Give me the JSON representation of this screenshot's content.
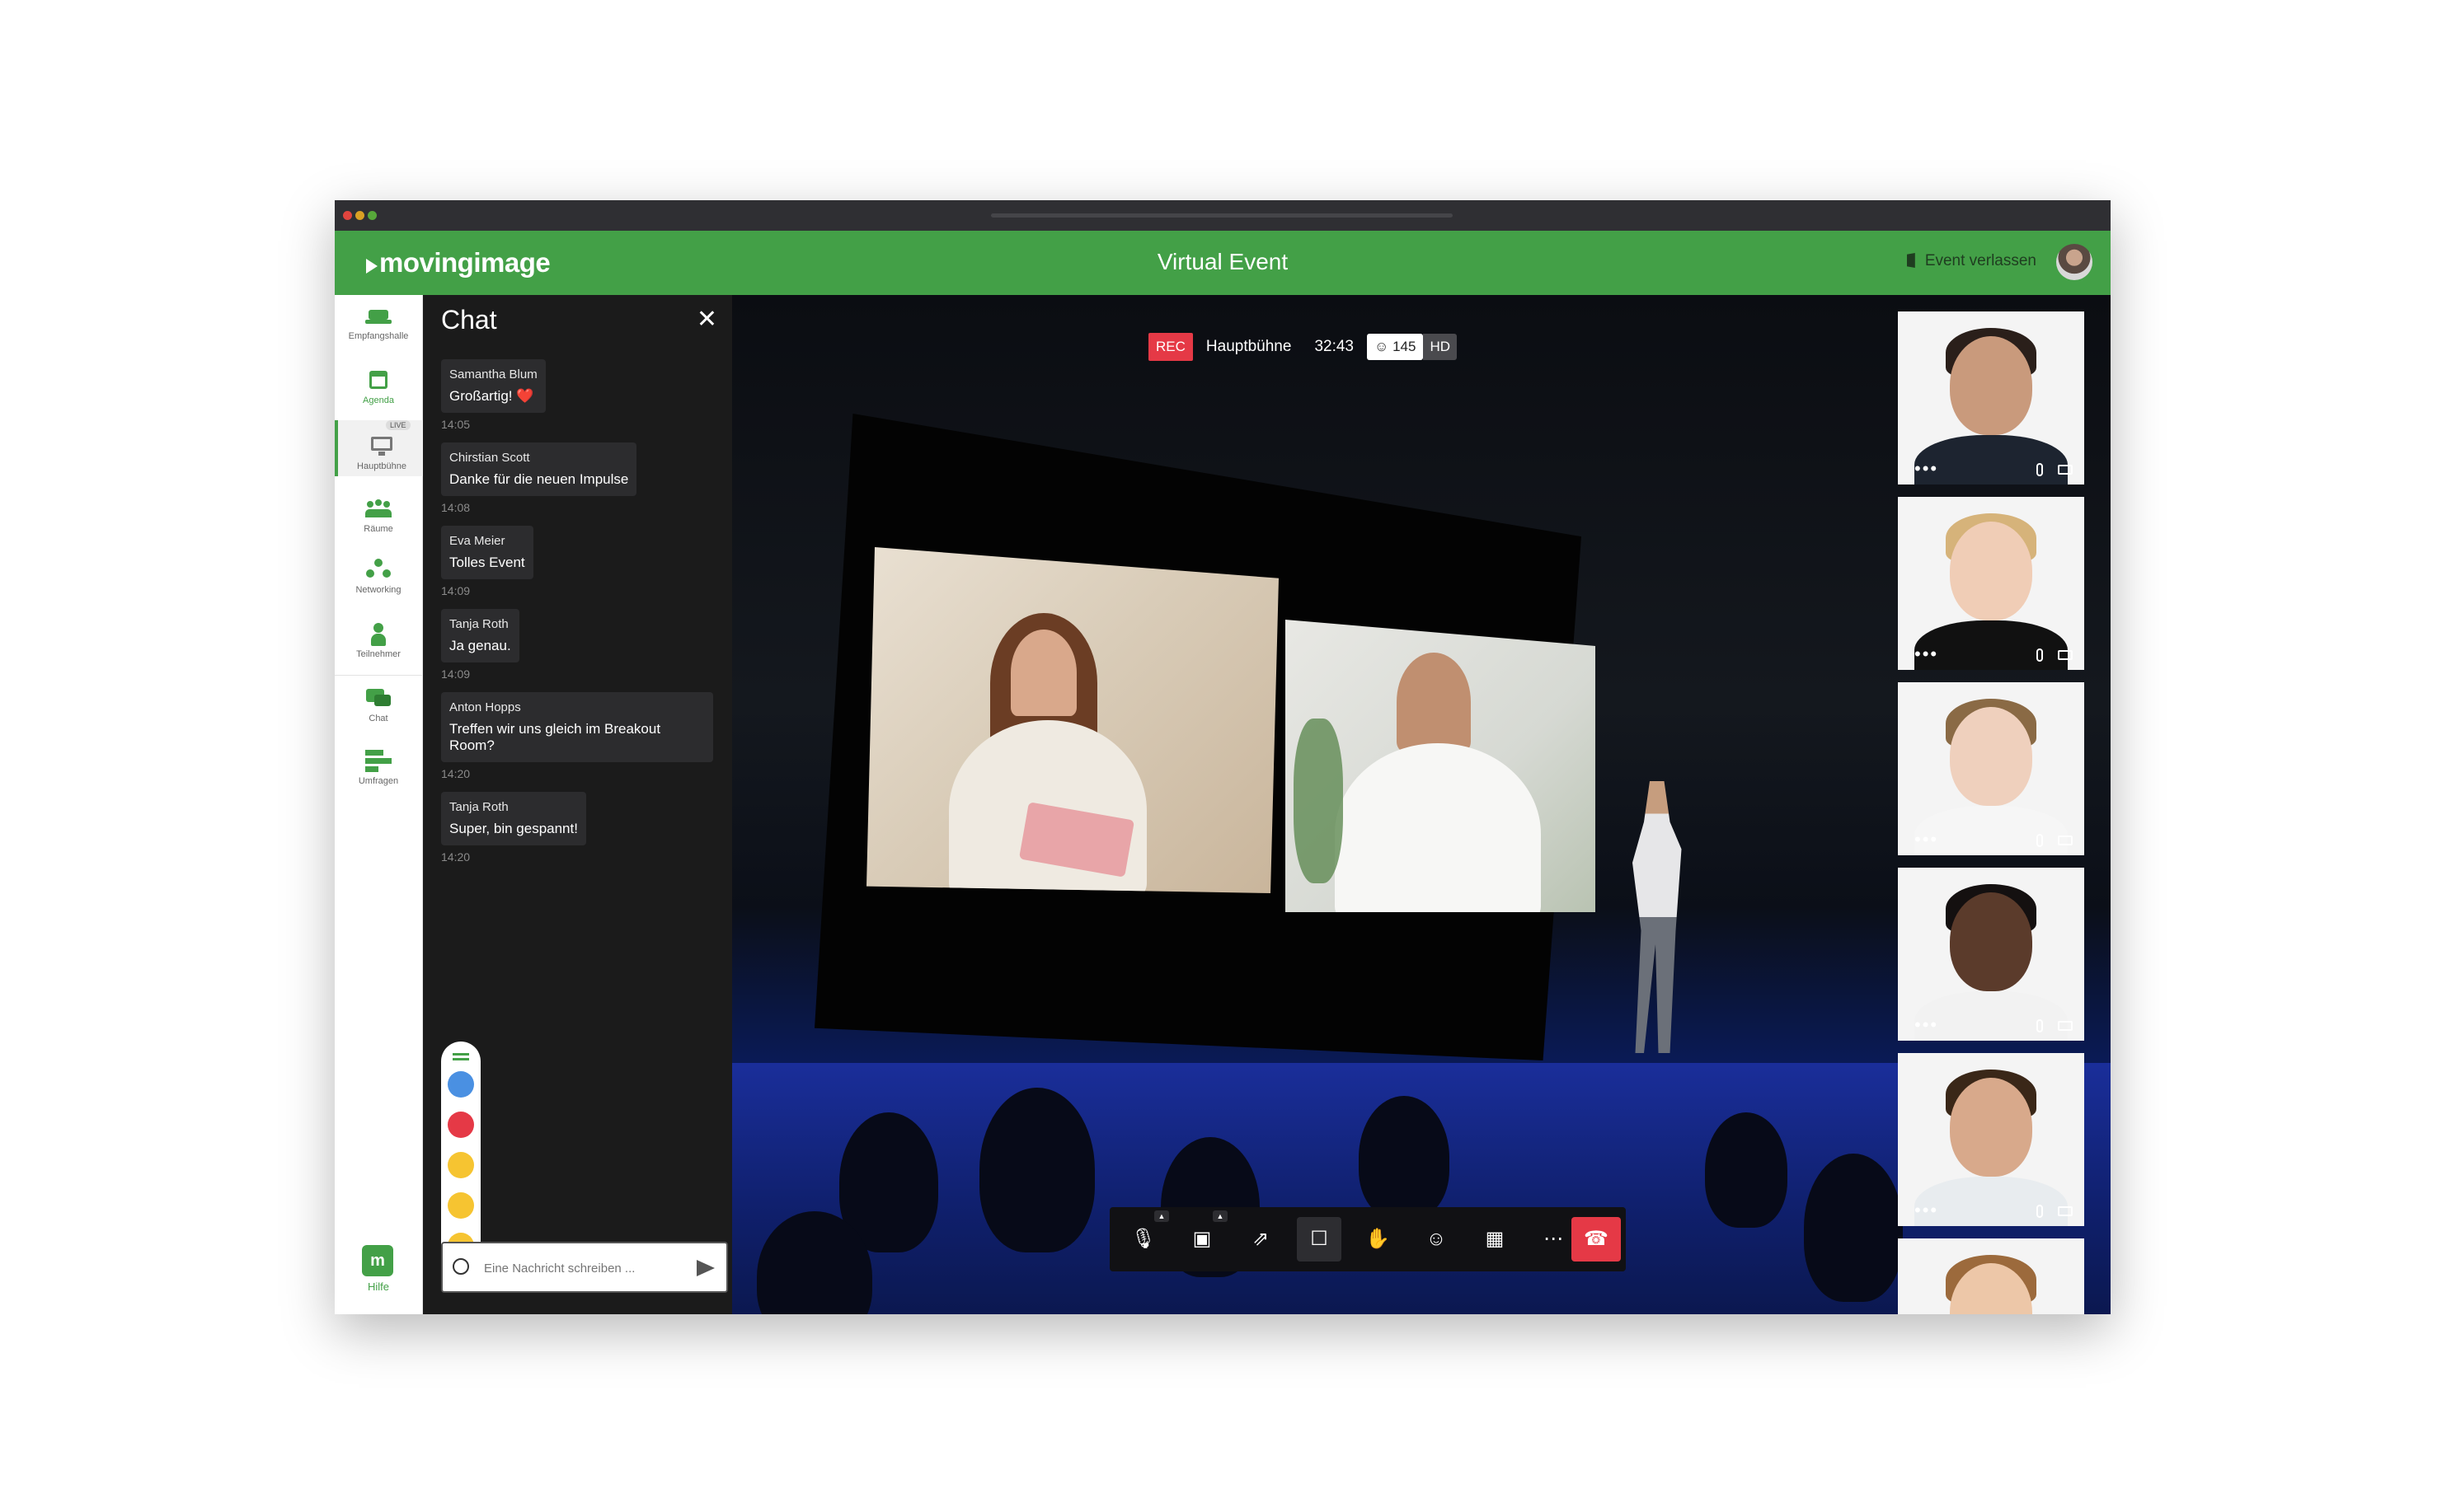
{
  "app": {
    "logo": "movingimage",
    "title": "Virtual Event",
    "leave_label": "Event verlassen"
  },
  "sidebar": {
    "items": [
      {
        "label": "Empfangshalle",
        "icon": "lobby-icon"
      },
      {
        "label": "Agenda",
        "icon": "calendar-icon"
      },
      {
        "label": "Hauptbühne",
        "icon": "monitor-icon",
        "badge": "LIVE"
      },
      {
        "label": "Räume",
        "icon": "rooms-icon"
      },
      {
        "label": "Networking",
        "icon": "networking-icon"
      },
      {
        "label": "Teilnehmer",
        "icon": "participant-icon"
      },
      {
        "label": "Chat",
        "icon": "chat-icon"
      },
      {
        "label": "Umfragen",
        "icon": "poll-icon"
      }
    ],
    "help_label": "Hilfe",
    "help_glyph": "m"
  },
  "chat": {
    "title": "Chat",
    "messages": [
      {
        "name": "Samantha Blum",
        "text": "Großartig! ❤️",
        "time": "14:05"
      },
      {
        "name": "Chirstian Scott",
        "text": "Danke für die neuen Impulse",
        "time": "14:08"
      },
      {
        "name": "Eva Meier",
        "text": "Tolles Event",
        "time": "14:09"
      },
      {
        "name": "Tanja Roth",
        "text": "Ja genau.",
        "time": "14:09"
      },
      {
        "name": "Anton Hopps",
        "text": "Treffen wir uns gleich im Breakout Room?",
        "time": "14:20"
      },
      {
        "name": "Tanja Roth",
        "text": "Super, bin gespannt!",
        "time": "14:20"
      }
    ],
    "reactions": [
      "thumbs-up-icon",
      "heart-icon",
      "laugh-icon",
      "wow-icon",
      "sad-icon"
    ],
    "input_placeholder": "Eine Nachricht schreiben ..."
  },
  "stage": {
    "rec": "REC",
    "room": "Hauptbühne",
    "duration": "32:43",
    "viewers": "145",
    "quality": "HD"
  },
  "controls": [
    {
      "name": "mute-mic-button",
      "glyph": "🎙"
    },
    {
      "name": "camera-off-button",
      "glyph": "▣"
    },
    {
      "name": "share-screen-button",
      "glyph": "⇗"
    },
    {
      "name": "chat-toggle-button",
      "glyph": "☐"
    },
    {
      "name": "raise-hand-button",
      "glyph": "✋"
    },
    {
      "name": "participants-button",
      "glyph": "☺"
    },
    {
      "name": "grid-view-button",
      "glyph": "▦"
    },
    {
      "name": "more-button",
      "glyph": "⋯"
    },
    {
      "name": "hang-up-button",
      "glyph": "☎"
    }
  ],
  "participants": [
    {
      "skin": "#c99a7c",
      "hair": "#2a1f1a",
      "shirt": "#1d2430"
    },
    {
      "skin": "#f0cdb6",
      "hair": "#d6b37a",
      "shirt": "#111111"
    },
    {
      "skin": "#efd0bd",
      "hair": "#8a6a45",
      "shirt": "#f6f6f6"
    },
    {
      "skin": "#5b3b2b",
      "hair": "#141010",
      "shirt": "#f2f2f2"
    },
    {
      "skin": "#d8a98b",
      "hair": "#3a2718",
      "shirt": "#e8ecef"
    },
    {
      "skin": "#edc7a8",
      "hair": "#9c6a3c",
      "shirt": "#f4f4f4"
    }
  ],
  "colors": {
    "brand": "#43a047",
    "rec": "#e53946",
    "hang": "#e53946"
  }
}
